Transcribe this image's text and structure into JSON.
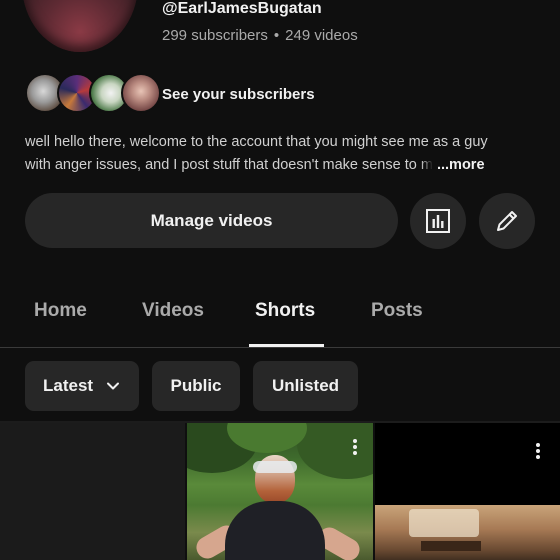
{
  "channel": {
    "handle": "@EarlJamesBugatan",
    "subscribers": "299 subscribers",
    "separator": "•",
    "videos": "249 videos"
  },
  "subscribers_link": "See your subscribers",
  "description": {
    "line1": "well hello there, welcome to the account that you might see me as a guy",
    "line2": "with anger issues, and I post stuff that doesn't make sense to ",
    "line2_faded": "m",
    "more": "...more"
  },
  "actions": {
    "manage_videos": "Manage videos",
    "analytics_icon": "analytics-bar-chart-icon",
    "edit_icon": "pencil-edit-icon"
  },
  "tabs": [
    {
      "label": "Home"
    },
    {
      "label": "Videos"
    },
    {
      "label": "Shorts"
    },
    {
      "label": "Posts"
    }
  ],
  "active_tab": "Shorts",
  "filters": {
    "latest": "Latest",
    "public": "Public",
    "unlisted": "Unlisted"
  },
  "colors": {
    "background": "#0f0f0f",
    "surface": "#272727",
    "text": "#f1f1f1",
    "muted": "#aaaaaa"
  }
}
